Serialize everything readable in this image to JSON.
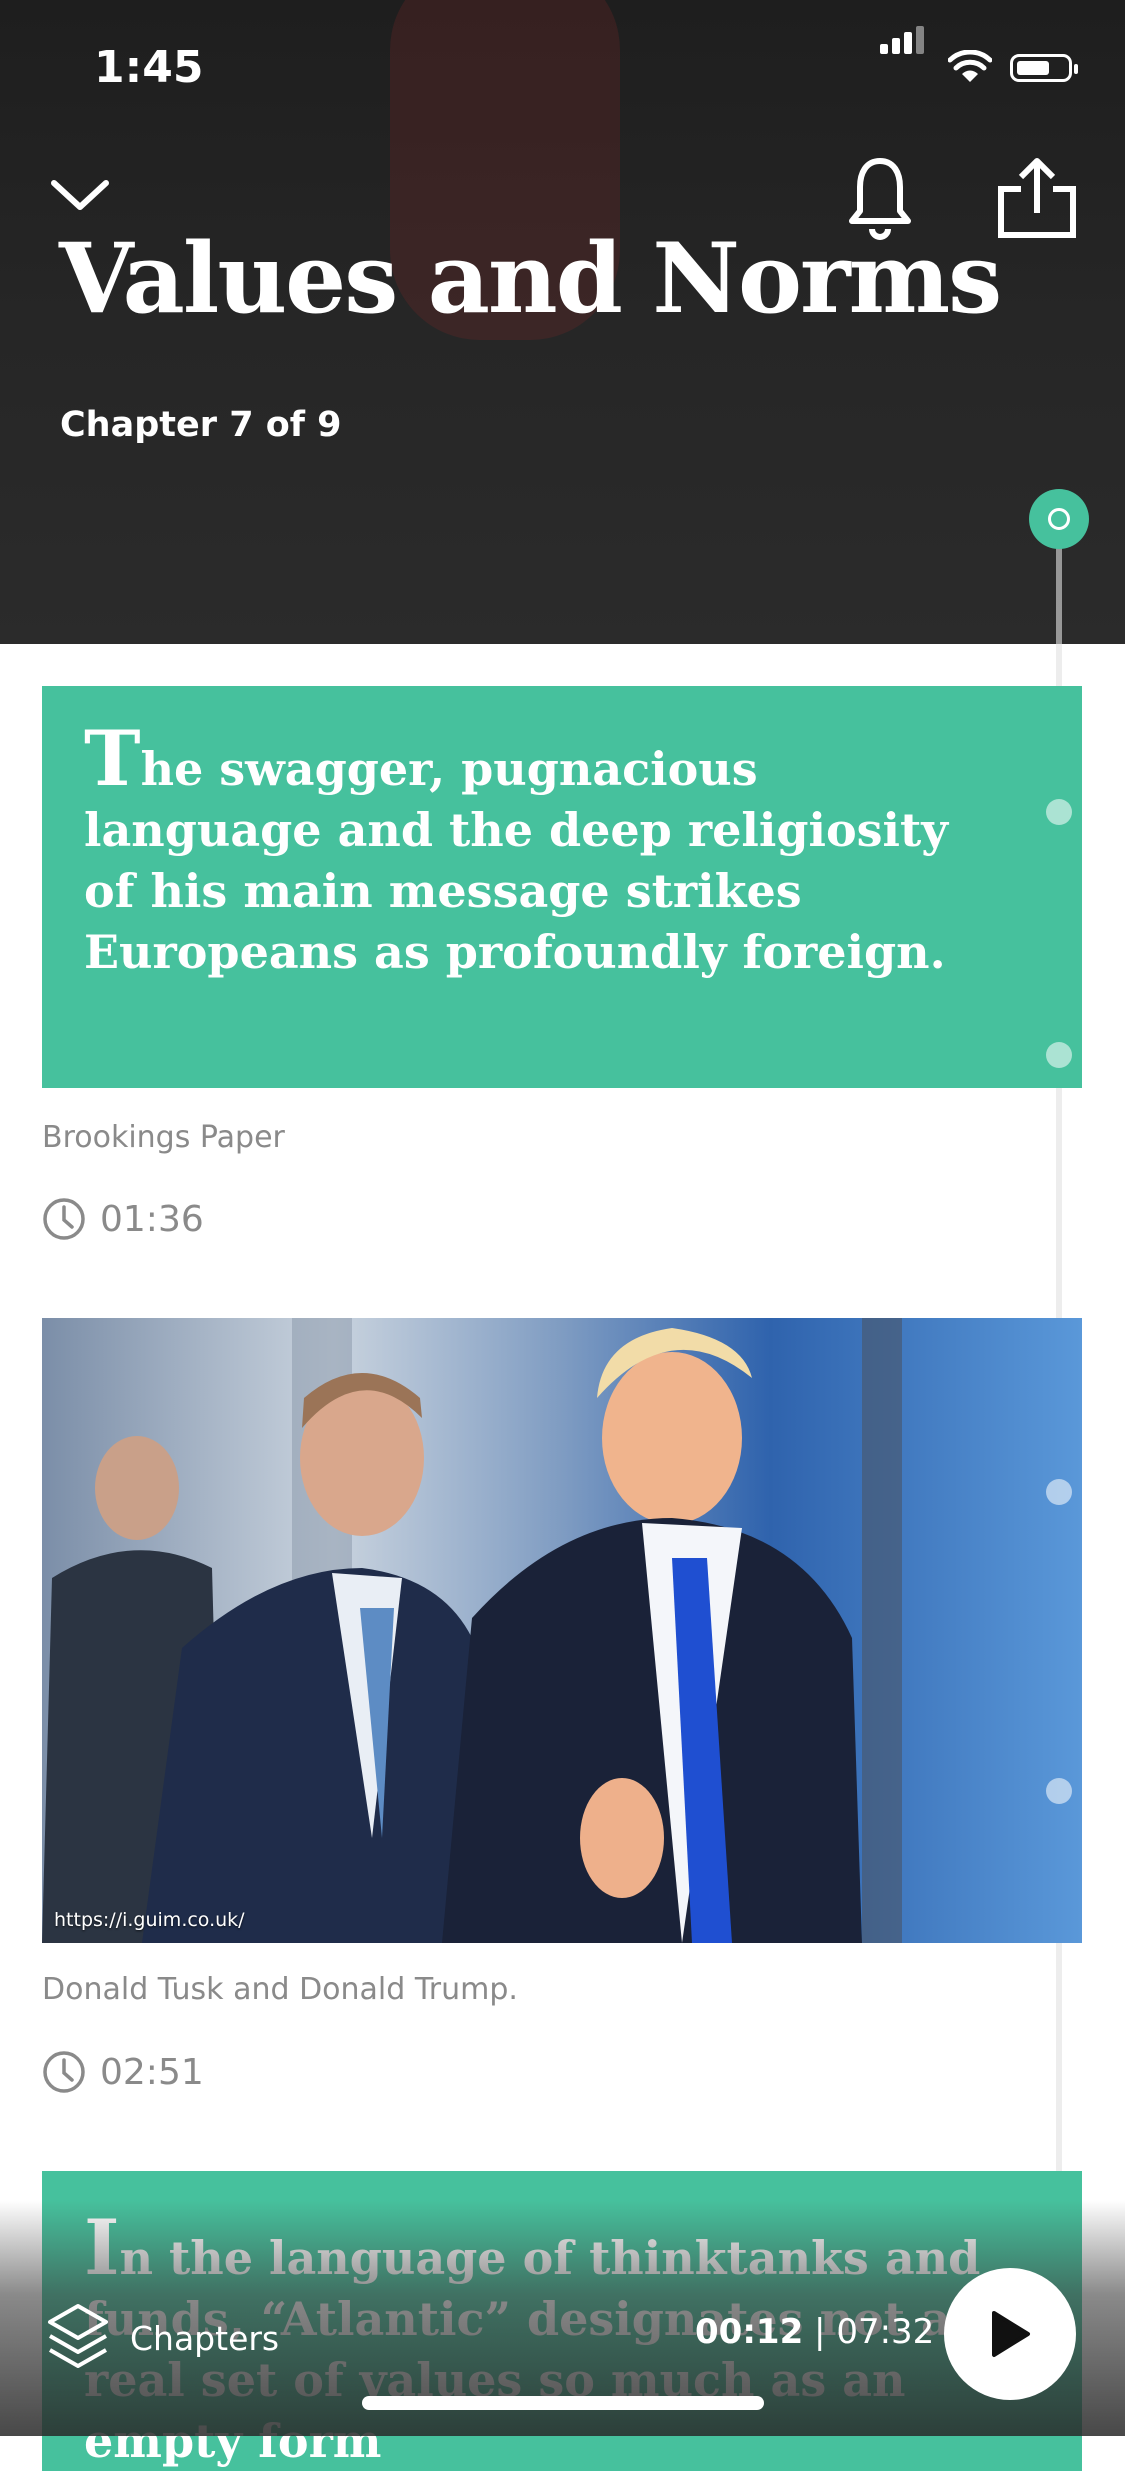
{
  "status_bar": {
    "time": "1:45"
  },
  "header": {
    "title": "Values and Norms",
    "chapter_label": "Chapter 7 of 9",
    "icons": {
      "collapse": "chevron-down-icon",
      "notify": "bell-icon",
      "share": "share-icon"
    }
  },
  "cards": [
    {
      "type": "quote",
      "dropcap": "T",
      "text": "he swagger, pugnacious language and the deep religiosity of his main message strikes Europeans as profoundly foreign.",
      "source": "Brookings Paper",
      "duration": "01:36"
    },
    {
      "type": "image",
      "credit": "https://i.guim.co.uk/",
      "caption": "Donald Tusk and Donald Trump.",
      "duration": "02:51"
    },
    {
      "type": "quote",
      "dropcap": "I",
      "text": "n the language of thinktanks and funds, “Atlantic” designates not a real set of values so much as an empty form"
    }
  ],
  "player": {
    "chapters_label": "Chapters",
    "elapsed": "00:12",
    "separator": " | ",
    "total": "07:32"
  },
  "colors": {
    "accent": "#46c19d",
    "header_bg": "#262626",
    "muted_text": "#8a8a8a"
  }
}
